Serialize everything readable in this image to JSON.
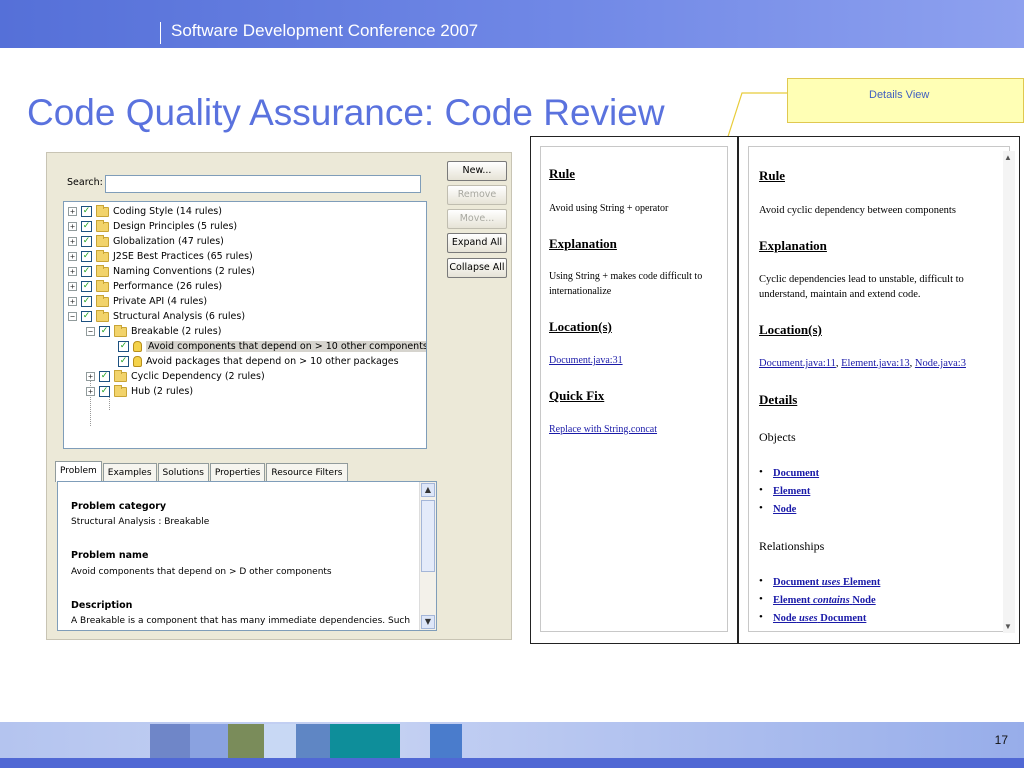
{
  "header": {
    "conference": "Software Development Conference 2007"
  },
  "slide": {
    "title": "Code Quality Assurance:  Code Review",
    "page_number": "17"
  },
  "callout": {
    "label": "Details View"
  },
  "config_panel": {
    "search_label": "Search:",
    "search_value": "",
    "buttons": {
      "new": "New...",
      "remove": "Remove",
      "move": "Move...",
      "expand_all": "Expand All",
      "collapse_all": "Collapse All"
    },
    "tree": [
      "Coding Style (14 rules)",
      "Design Principles (5 rules)",
      "Globalization (47 rules)",
      "J2SE Best Practices (65 rules)",
      "Naming Conventions (2 rules)",
      "Performance (26 rules)",
      "Private API (4 rules)",
      "Structural Analysis (6 rules)",
      "Breakable (2 rules)",
      "Avoid components that depend on > 10 other components",
      "Avoid packages that depend on > 10 other packages",
      "Cyclic Dependency (2 rules)",
      "Hub (2 rules)"
    ],
    "tabs": [
      "Problem",
      "Examples",
      "Solutions",
      "Properties",
      "Resource Filters"
    ],
    "problem": {
      "category_heading": "Problem category",
      "category_value": "Structural Analysis : Breakable",
      "name_heading": "Problem name",
      "name_value": "Avoid components that depend on > D other components",
      "description_heading": "Description",
      "description_value": "A Breakable is a component that has many immediate dependencies. Such"
    }
  },
  "details_left": {
    "rule_heading": "Rule",
    "rule_text": "Avoid using String + operator",
    "explanation_heading": "Explanation",
    "explanation_line1": "Using String + makes code difficult to",
    "explanation_line2": "internationalize",
    "location_heading": "Location(s)",
    "location_link": "Document.java:31",
    "quickfix_heading": "Quick Fix",
    "quickfix_link": "Replace with String.concat"
  },
  "details_right": {
    "rule_heading": "Rule",
    "rule_text": "Avoid cyclic dependency between components",
    "explanation_heading": "Explanation",
    "explanation_line1": "Cyclic dependencies lead to unstable, difficult to",
    "explanation_line2": "understand, maintain and extend code.",
    "location_heading": "Location(s)",
    "location_links": [
      "Document.java:11",
      "Element.java:13",
      "Node.java:3"
    ],
    "details_heading": "Details",
    "objects_heading": "Objects",
    "objects": [
      "Document",
      "Element",
      "Node"
    ],
    "relationships_heading": "Relationships",
    "relationships": [
      {
        "subject": "Document",
        "verb": "uses",
        "object": "Element"
      },
      {
        "subject": "Element",
        "verb": "contains",
        "object": "Node"
      },
      {
        "subject": "Node",
        "verb": "uses",
        "object": "Document"
      }
    ]
  }
}
